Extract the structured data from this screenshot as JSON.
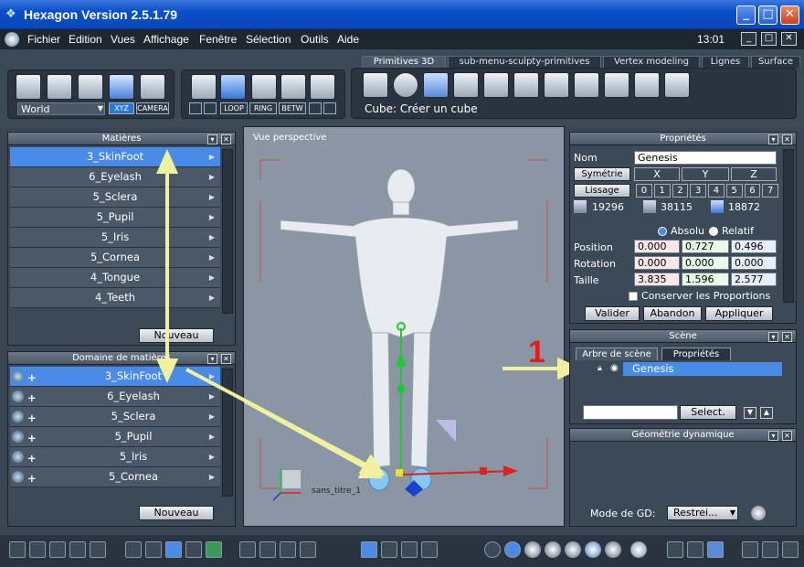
{
  "window": {
    "title": "Hexagon Version 2.5.1.79",
    "minimize": "_",
    "maximize": "□",
    "close": "✕"
  },
  "menu": {
    "items": [
      "Fichier",
      "Edition",
      "Vues",
      "Affichage",
      "Fenêtre",
      "Sélection",
      "Outils",
      "Aide"
    ],
    "time": "13:01"
  },
  "toolbar": {
    "coord_select": "World",
    "xyz_label": "XYZ",
    "camera_label": "CAMERA",
    "loop_label": "LOOP",
    "ring_label": "RING",
    "betw_label": "BETW",
    "tabs": [
      "Primitives 3D",
      "sub-menu-sculpty-primitives",
      "Vertex modeling",
      "Lignes",
      "Surface"
    ],
    "hint": "Cube: Créer un cube"
  },
  "materials": {
    "title": "Matières",
    "items": [
      "3_SkinFoot",
      "6_Eyelash",
      "5_Sclera",
      "5_Pupil",
      "5_Iris",
      "5_Cornea",
      "4_Tongue",
      "4_Teeth"
    ],
    "new_button": "Nouveau"
  },
  "domain": {
    "title": "Domaine de matières",
    "items": [
      "3_SkinFoot",
      "6_Eyelash",
      "5_Sclera",
      "5_Pupil",
      "5_Iris",
      "5_Cornea"
    ],
    "new_button": "Nouveau"
  },
  "viewport": {
    "label": "Vue perspective",
    "object_label": "sans_titre_1"
  },
  "properties": {
    "title": "Propriétés",
    "name_label": "Nom",
    "name_value": "Genesis",
    "symmetry_label": "Symétrie",
    "axes": [
      "X",
      "Y",
      "Z"
    ],
    "smooth_label": "Lissage",
    "smooth_levels": [
      "0",
      "1",
      "2",
      "3",
      "4",
      "5",
      "6",
      "7"
    ],
    "counts": [
      "19296",
      "38115",
      "18872"
    ],
    "absolute": "Absolu",
    "relative": "Relatif",
    "position_label": "Position",
    "position": [
      "0.000",
      "0.727",
      "0.496"
    ],
    "rotation_label": "Rotation",
    "rotation": [
      "0.000",
      "0.000",
      "0.000"
    ],
    "size_label": "Taille",
    "size": [
      "3.835",
      "1.596",
      "2.577"
    ],
    "keep_ratio": "Conserver les Proportions",
    "validate": "Valider",
    "cancel": "Abandon",
    "apply": "Appliquer"
  },
  "scene": {
    "title": "Scène",
    "tabs": [
      "Arbre de scène",
      "Propriétés"
    ],
    "item": "Genesis",
    "select_button": "Select.",
    "annotation": "1"
  },
  "dyn_geo": {
    "title": "Géométrie dynamique",
    "mode_label": "Mode de GD:",
    "mode_value": "Restrei..."
  },
  "colors": {
    "accent": "#4a8be8",
    "annotation_arrow": "#f0f0a0",
    "annotation_number": "#e02020"
  }
}
